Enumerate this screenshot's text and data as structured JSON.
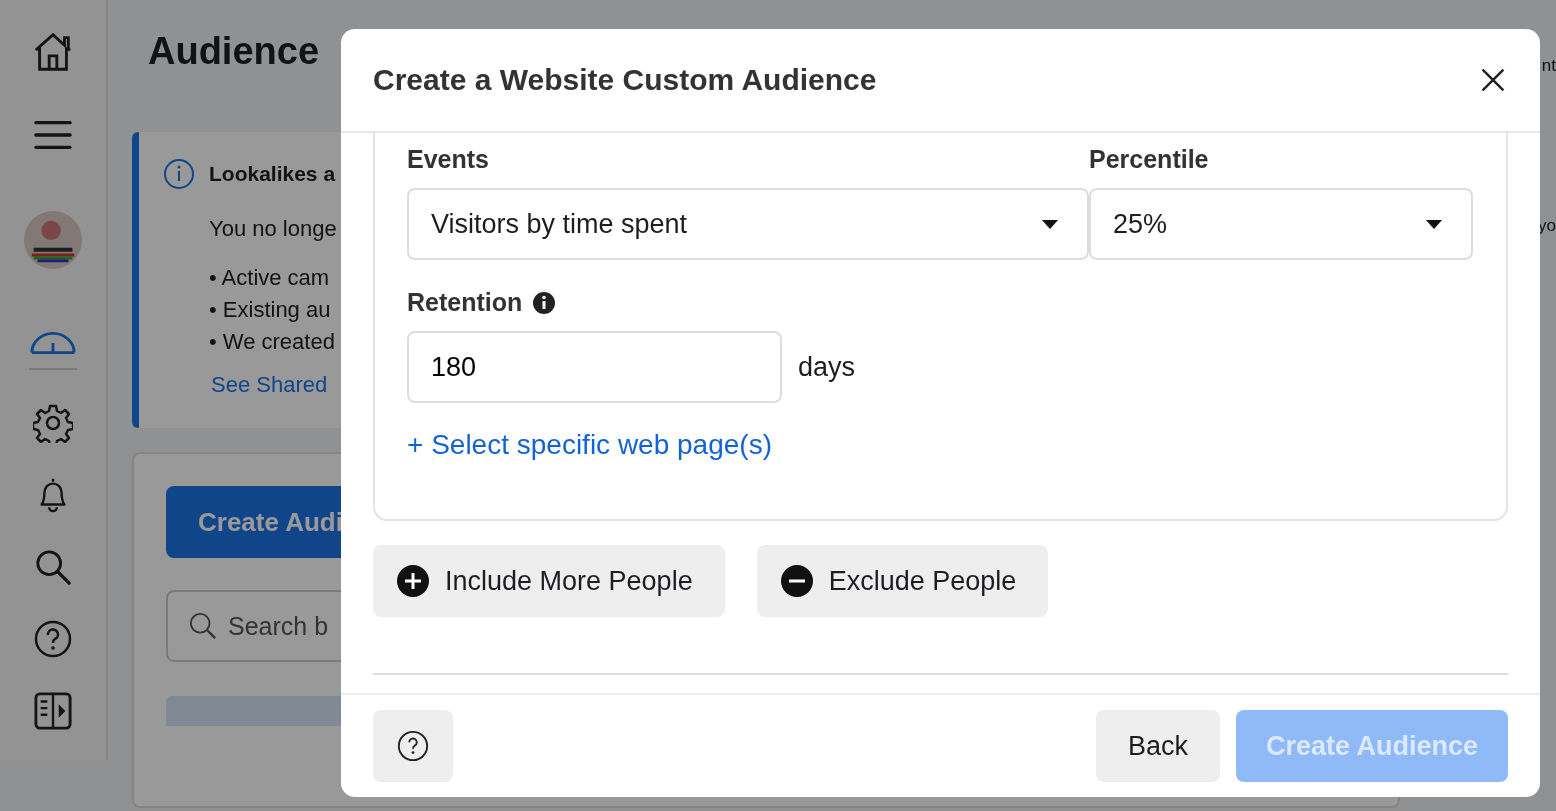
{
  "sidebar": {
    "items": [
      {
        "selected": false
      },
      {
        "selected": false
      },
      {
        "selected": false
      },
      {
        "selected": true
      },
      {
        "selected": false
      },
      {
        "selected": false
      },
      {
        "selected": false
      },
      {
        "selected": false
      },
      {
        "selected": false
      }
    ]
  },
  "page": {
    "title": "Audience",
    "notice": {
      "title": "Lookalikes a",
      "text": "You no longe",
      "bullets": [
        "• Active cam",
        "• Existing au",
        "• We created"
      ],
      "link": "See Shared"
    },
    "create_button": "Create Audi",
    "search": {
      "placeholder": "Search b"
    },
    "right_fragments": [
      "nt",
      "yo"
    ]
  },
  "dialog": {
    "title": "Create a Website Custom Audience",
    "events": {
      "label": "Events",
      "value": "Visitors by time spent"
    },
    "percentile": {
      "label": "Percentile",
      "value": "25%"
    },
    "retention": {
      "label": "Retention",
      "value": "180",
      "unit": "days"
    },
    "link": "+ Select specific web page(s)",
    "actions": [
      {
        "kind": "include",
        "label": "Include More People"
      },
      {
        "kind": "exclude",
        "label": "Exclude People"
      }
    ],
    "footer": {
      "back": "Back",
      "create": "Create Audience",
      "create_disabled": true
    }
  }
}
